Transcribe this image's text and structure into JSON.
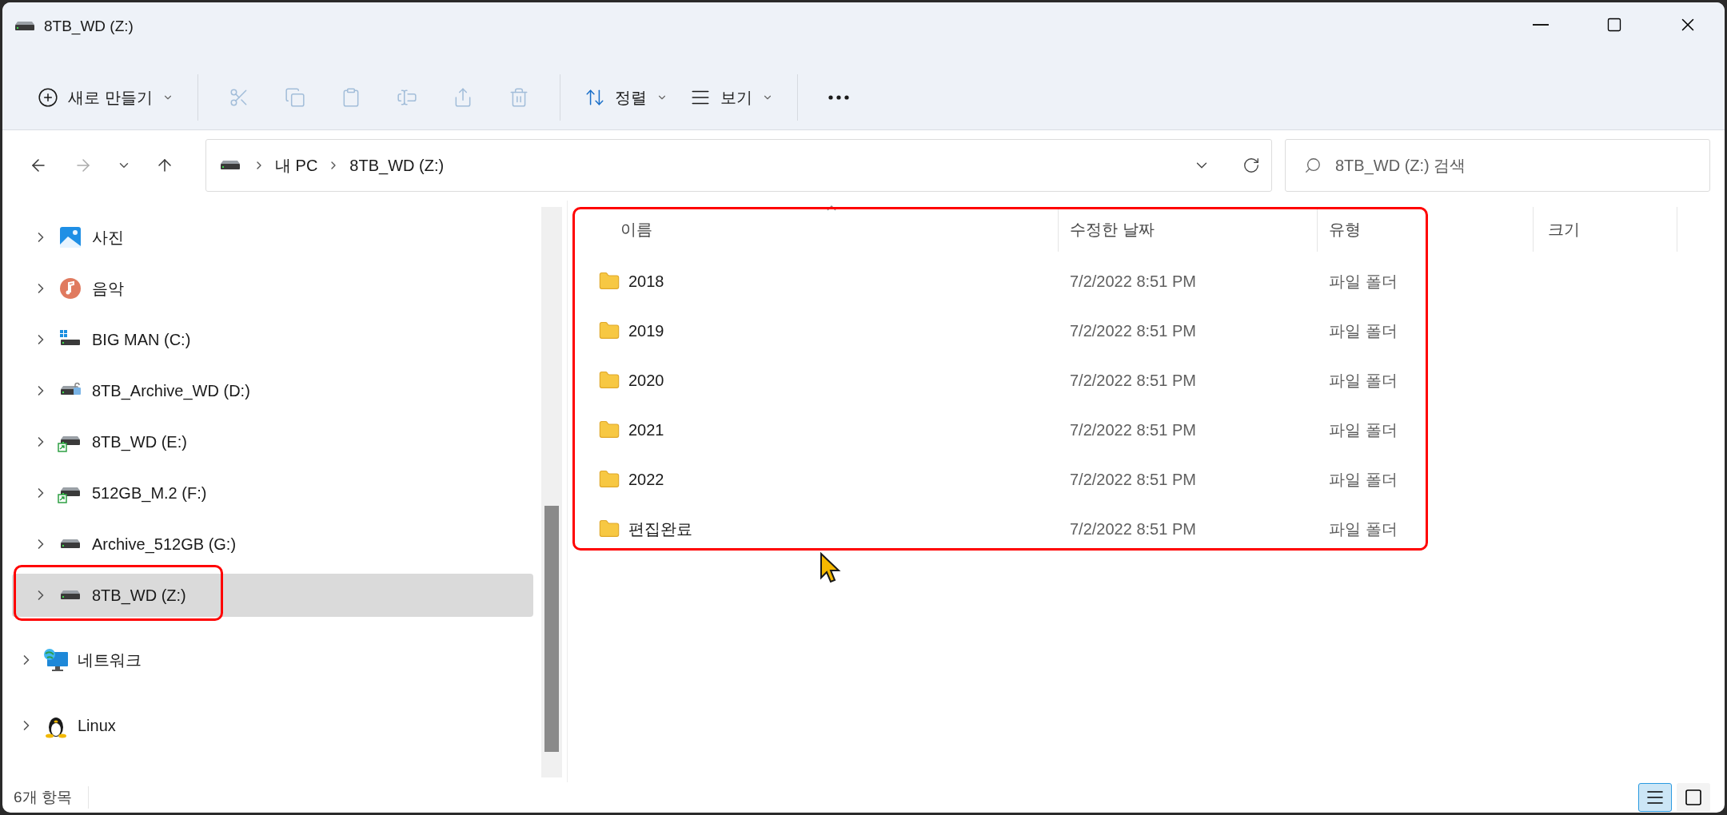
{
  "window": {
    "title": "8TB_WD (Z:)"
  },
  "toolbar": [
    {
      "kind": "new",
      "label": "새로 만들기",
      "disabled": false
    },
    {
      "kind": "cut",
      "disabled": true
    },
    {
      "kind": "copy",
      "disabled": true
    },
    {
      "kind": "paste",
      "disabled": true
    },
    {
      "kind": "rename",
      "disabled": true
    },
    {
      "kind": "share",
      "disabled": true
    },
    {
      "kind": "delete",
      "disabled": true
    },
    {
      "kind": "sort",
      "label": "정렬",
      "disabled": false
    },
    {
      "kind": "view",
      "label": "보기",
      "disabled": false
    },
    {
      "kind": "more",
      "disabled": false
    }
  ],
  "nav": {
    "back_disabled": false,
    "forward_disabled": true,
    "up_disabled": false
  },
  "address": {
    "crumbs": [
      "내 PC",
      "8TB_WD (Z:)"
    ]
  },
  "search": {
    "placeholder": "8TB_WD (Z:) 검색"
  },
  "sidebar": {
    "this_pc_children": [
      {
        "kind": "photos",
        "label": "사진",
        "expanded": false,
        "selected": false
      },
      {
        "kind": "music",
        "label": "음악",
        "expanded": false,
        "selected": false
      },
      {
        "kind": "system-drive",
        "label": "BIG MAN (C:)",
        "expanded": false,
        "selected": false
      },
      {
        "kind": "locked-drive",
        "label": "8TB_Archive_WD (D:)",
        "expanded": false,
        "selected": false
      },
      {
        "kind": "shared-drive",
        "label": "8TB_WD (E:)",
        "expanded": false,
        "selected": false
      },
      {
        "kind": "shared-drive",
        "label": "512GB_M.2 (F:)",
        "expanded": false,
        "selected": false
      },
      {
        "kind": "drive",
        "label": "Archive_512GB (G:)",
        "expanded": false,
        "selected": false
      },
      {
        "kind": "drive",
        "label": "8TB_WD (Z:)",
        "expanded": false,
        "selected": true
      }
    ],
    "items": [
      {
        "kind": "network",
        "label": "네트워크",
        "expanded": false,
        "selected": false
      },
      {
        "kind": "linux",
        "label": "Linux",
        "expanded": false,
        "selected": false
      }
    ]
  },
  "table": {
    "columns": [
      "이름",
      "수정한 날짜",
      "유형",
      "크기"
    ],
    "rows": [
      {
        "name": "2018",
        "modified": "7/2/2022 8:51 PM",
        "type": "파일 폴더"
      },
      {
        "name": "2019",
        "modified": "7/2/2022 8:51 PM",
        "type": "파일 폴더"
      },
      {
        "name": "2020",
        "modified": "7/2/2022 8:51 PM",
        "type": "파일 폴더"
      },
      {
        "name": "2021",
        "modified": "7/2/2022 8:51 PM",
        "type": "파일 폴더"
      },
      {
        "name": "2022",
        "modified": "7/2/2022 8:51 PM",
        "type": "파일 폴더"
      },
      {
        "name": "편집완료",
        "modified": "7/2/2022 8:51 PM",
        "type": "파일 폴더"
      }
    ]
  },
  "status_bar": {
    "count": "6개 항목",
    "views": [
      {
        "kind": "details",
        "selected": true
      },
      {
        "kind": "tiles",
        "selected": false
      }
    ]
  }
}
